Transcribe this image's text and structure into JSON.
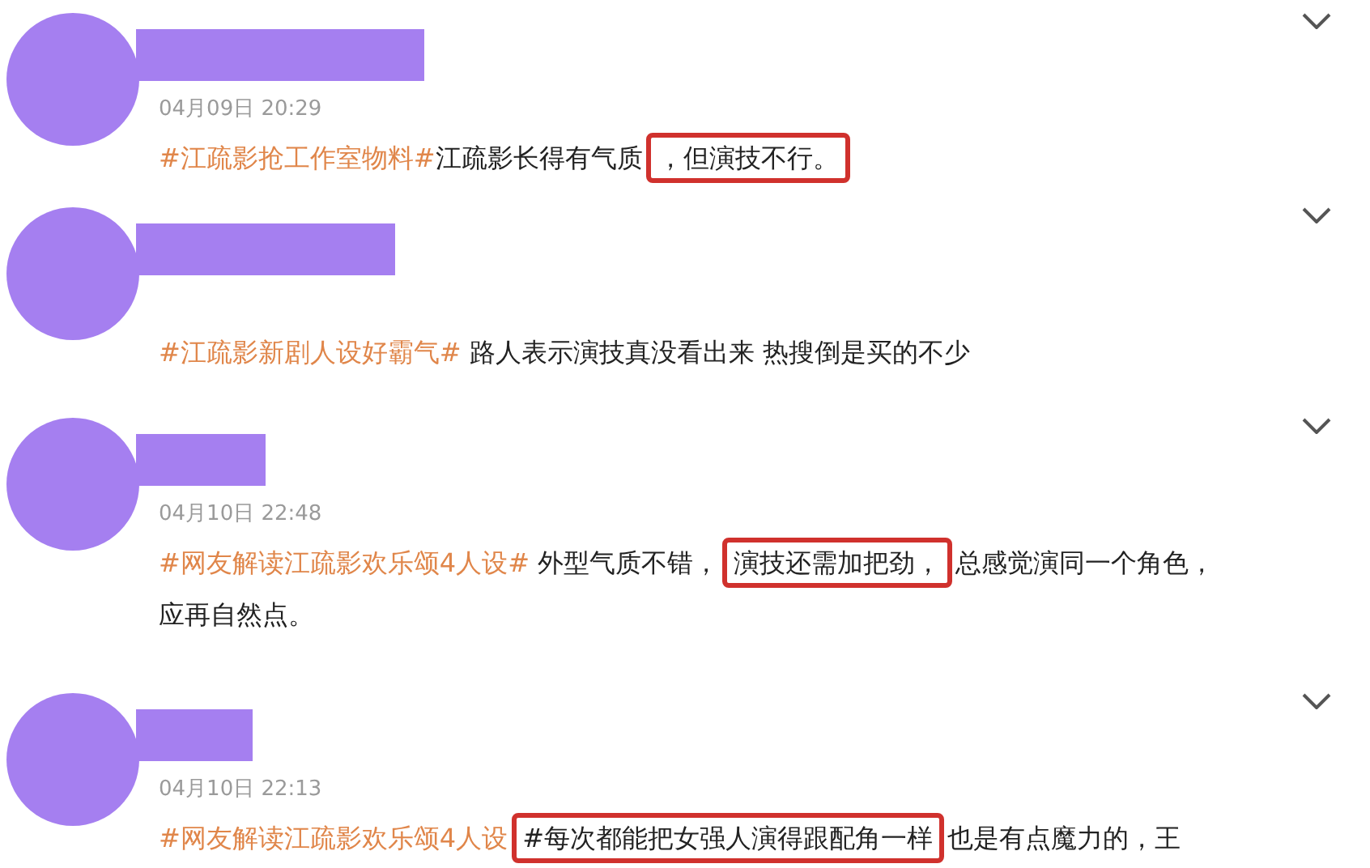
{
  "comments": [
    {
      "date": "04月09日 20:29",
      "segments": [
        {
          "kind": "hashtag",
          "text": "#江疏影抢工作室物料#"
        },
        {
          "kind": "plain",
          "text": "江疏影长得有气质"
        },
        {
          "kind": "highlight",
          "text": "，但演技不行。"
        }
      ]
    },
    {
      "segments": [
        {
          "kind": "hashtag",
          "text": "#江疏影新剧人设好霸气#"
        },
        {
          "kind": "plain",
          "text": " 路人表示演技真没看出来 热搜倒是买的不少"
        }
      ]
    },
    {
      "date": "04月10日 22:48",
      "segments": [
        {
          "kind": "hashtag",
          "text": "#网友解读江疏影欢乐颂4人设#"
        },
        {
          "kind": "plain",
          "text": " 外型气质不错，"
        },
        {
          "kind": "highlight",
          "text": "演技还需加把劲，"
        },
        {
          "kind": "plain",
          "text": "总感觉演同一个角色，应再自然点。"
        }
      ]
    },
    {
      "date": "04月10日 22:13",
      "segments": [
        {
          "kind": "hashtag",
          "text": "#网友解读江疏影欢乐颂4人设"
        },
        {
          "kind": "highlight",
          "text": "#每次都能把女强人演得跟配角一样"
        },
        {
          "kind": "plain",
          "text": "也是有点魔力的，王"
        }
      ]
    }
  ]
}
